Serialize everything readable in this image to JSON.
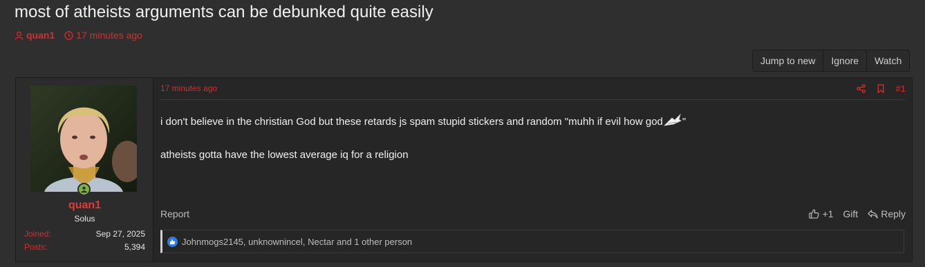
{
  "thread": {
    "title": "most of atheists arguments can be debunked quite easily",
    "author": "quan1",
    "time_ago": "17 minutes ago"
  },
  "thread_actions": [
    {
      "label": "Jump to new"
    },
    {
      "label": "Ignore"
    },
    {
      "label": "Watch"
    }
  ],
  "post": {
    "user": {
      "name": "quan1",
      "title": "Solus",
      "joined_label": "Joined:",
      "joined": "Sep 27, 2025",
      "posts_label": "Posts:",
      "posts": "5,394",
      "online": true
    },
    "time_ago": "17 minutes ago",
    "number": "#1",
    "body_line1_before": "i don't believe in the christian God but these retards js spam stupid stickers and random \"muhh if evil how god",
    "body_line1_after": "\"",
    "body_line2": "atheists gotta have the lowest average iq for a religion",
    "footer": {
      "report": "Report",
      "like_count": "+1",
      "gift": "Gift",
      "reply": "Reply"
    },
    "reactions_text": "Johnmogs2145, unknownincel, Nectar and 1 other person"
  },
  "colors": {
    "accent_red": "#d32f2f",
    "username_red": "#e53935",
    "like_blue": "#2e7ce5",
    "background": "#2f2f2f",
    "post_background": "#262626"
  },
  "icons": {
    "author": "user-icon",
    "time": "clock-icon",
    "share": "share-icon",
    "bookmark": "bookmark-icon",
    "like": "thumbs-up-icon",
    "reply": "reply-arrow-icon",
    "online": "online-status-icon",
    "sticker": "sticker-icon"
  }
}
